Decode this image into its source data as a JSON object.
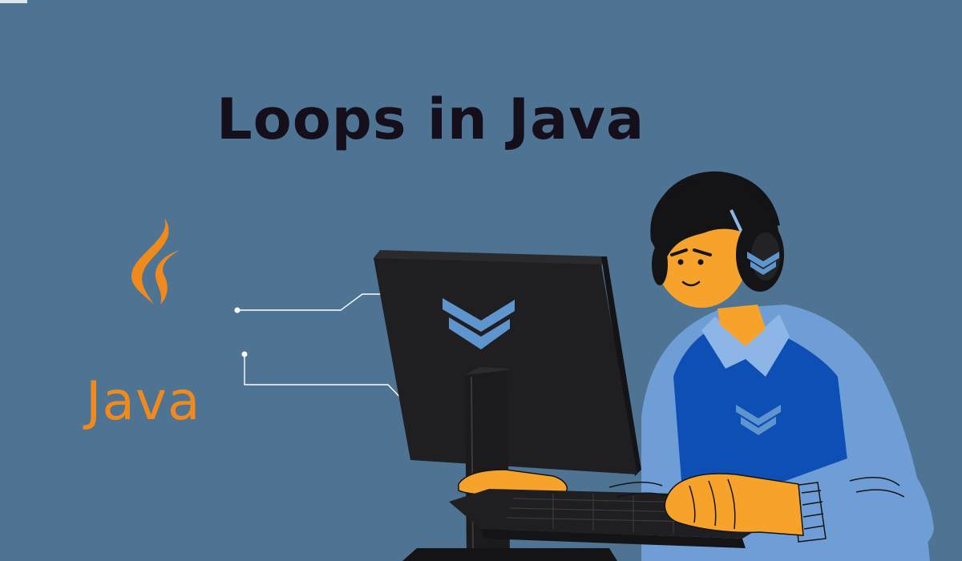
{
  "page": {
    "title": "Loops in Java",
    "brand_word": "Java"
  },
  "colors": {
    "background": "#4e7393",
    "title_text": "#140f1a",
    "java_orange": "#f08a1c",
    "monitor": "#1f1f21",
    "chevron": "#5f95cf",
    "shirt": "#6f9ed6",
    "vest": "#0d4fb5",
    "skin": "#f7a32b",
    "hair": "#141416"
  },
  "icons": [
    "java-flame-icon",
    "chevron-emblem-icon",
    "headphones-icon"
  ]
}
